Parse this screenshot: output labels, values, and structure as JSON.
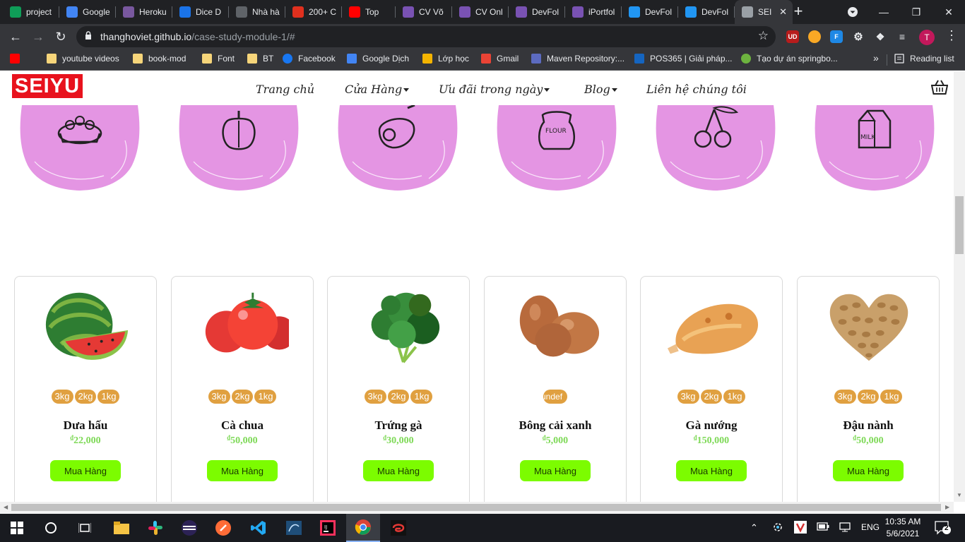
{
  "browser": {
    "tabs": [
      {
        "title": "project",
        "icon_color": "#0f9d58",
        "icon": "sheets-icon"
      },
      {
        "title": "Google",
        "icon_color": "#4285f4",
        "icon": "translate-icon"
      },
      {
        "title": "Heroku",
        "icon_color": "#79589f",
        "icon": "heroku-icon"
      },
      {
        "title": "Dice D",
        "icon_color": "#1a73e8",
        "icon": "flag-icon"
      },
      {
        "title": "Nhà hà",
        "icon_color": "#5f6368",
        "icon": "eye-icon"
      },
      {
        "title": "200+ C",
        "icon_color": "#e0301e",
        "icon": "adobe-icon"
      },
      {
        "title": "Top",
        "icon_color": "#ff0000",
        "icon": "youtube-icon"
      },
      {
        "title": "CV Võ",
        "icon_color": "#7952b3",
        "icon": "bootstrap-icon"
      },
      {
        "title": "CV Onl",
        "icon_color": "#7952b3",
        "icon": "bootstrap-icon"
      },
      {
        "title": "DevFol",
        "icon_color": "#7952b3",
        "icon": "bootstrap-icon"
      },
      {
        "title": "iPortfol",
        "icon_color": "#7952b3",
        "icon": "bootstrap-icon"
      },
      {
        "title": "DevFol",
        "icon_color": "#2196f3",
        "icon": "devfolio-icon"
      },
      {
        "title": "DevFol",
        "icon_color": "#2196f3",
        "icon": "devfolio-icon"
      },
      {
        "title": "SEI",
        "icon_color": "#9aa0a6",
        "icon": "globe-icon"
      }
    ],
    "url_host": "thanghoviet.github.io",
    "url_path": "/case-study-module-1/#",
    "bookmarks": [
      {
        "label": "",
        "icon": "youtube-icon"
      },
      {
        "label": "youtube videos",
        "icon": "folder-icon"
      },
      {
        "label": "book-mod",
        "icon": "folder-icon"
      },
      {
        "label": "Font",
        "icon": "folder-icon"
      },
      {
        "label": "BT",
        "icon": "folder-icon"
      },
      {
        "label": "Facebook",
        "icon": "facebook-icon"
      },
      {
        "label": "Google Dịch",
        "icon": "translate-icon"
      },
      {
        "label": "Lớp học",
        "icon": "classroom-icon"
      },
      {
        "label": "Gmail",
        "icon": "gmail-icon"
      },
      {
        "label": "Maven Repository:...",
        "icon": "maven-icon"
      },
      {
        "label": "POS365 | Giải pháp...",
        "icon": "pos365-icon"
      },
      {
        "label": "Tạo dự án springbo...",
        "icon": "spring-icon"
      }
    ],
    "bookmarks_overflow": "»",
    "reading_list": "Reading list",
    "avatar_letter": "T"
  },
  "site": {
    "logo": "SEIYU",
    "nav": [
      {
        "label": "Trang chủ",
        "dropdown": false
      },
      {
        "label": "Cửa Hàng",
        "dropdown": true
      },
      {
        "label": "Ưu đãi trong ngày",
        "dropdown": true
      },
      {
        "label": "Blog",
        "dropdown": true
      },
      {
        "label": "Liên hệ chúng tôi",
        "dropdown": false
      }
    ],
    "categories": [
      {
        "icon": "eggs-icon"
      },
      {
        "icon": "pepper-icon"
      },
      {
        "icon": "meat-icon"
      },
      {
        "icon": "flour-icon",
        "text": "FLOUR"
      },
      {
        "icon": "cherry-icon"
      },
      {
        "icon": "milk-icon",
        "text": "MILK"
      }
    ],
    "category_color": "#e495e3",
    "products": [
      {
        "name": "Dưa hấu",
        "price": "22,000",
        "sizes": [
          "3kg",
          "2kg",
          "1kg"
        ],
        "button": "Mua Hàng",
        "image": "watermelon-image"
      },
      {
        "name": "Cà chua",
        "price": "50,000",
        "sizes": [
          "3kg",
          "2kg",
          "1kg"
        ],
        "button": "Mua Hàng",
        "image": "tomato-image"
      },
      {
        "name": "Trứng gà",
        "price": "30,000",
        "sizes": [
          "3kg",
          "2kg",
          "1kg"
        ],
        "button": "Mua Hàng",
        "image": "kale-image"
      },
      {
        "name": "Bông cải xanh",
        "price": "5,000",
        "sizes": [
          "undef"
        ],
        "button": "Mua Hàng",
        "image": "eggs-image"
      },
      {
        "name": "Gà nướng",
        "price": "150,000",
        "sizes": [
          "3kg",
          "2kg",
          "1kg"
        ],
        "button": "Mua Hàng",
        "image": "chicken-image"
      },
      {
        "name": "Đậu nành",
        "price": "50,000",
        "sizes": [
          "3kg",
          "2kg",
          "1kg"
        ],
        "button": "Mua Hàng",
        "image": "pistachio-heart-image"
      }
    ],
    "currency": "₫",
    "size_color": "#e0a040",
    "button_color": "#7cfc00",
    "price_color": "#7ed957"
  },
  "taskbar": {
    "language": "ENG",
    "time": "10:35 AM",
    "date": "5/6/2021",
    "notifications": "2"
  }
}
